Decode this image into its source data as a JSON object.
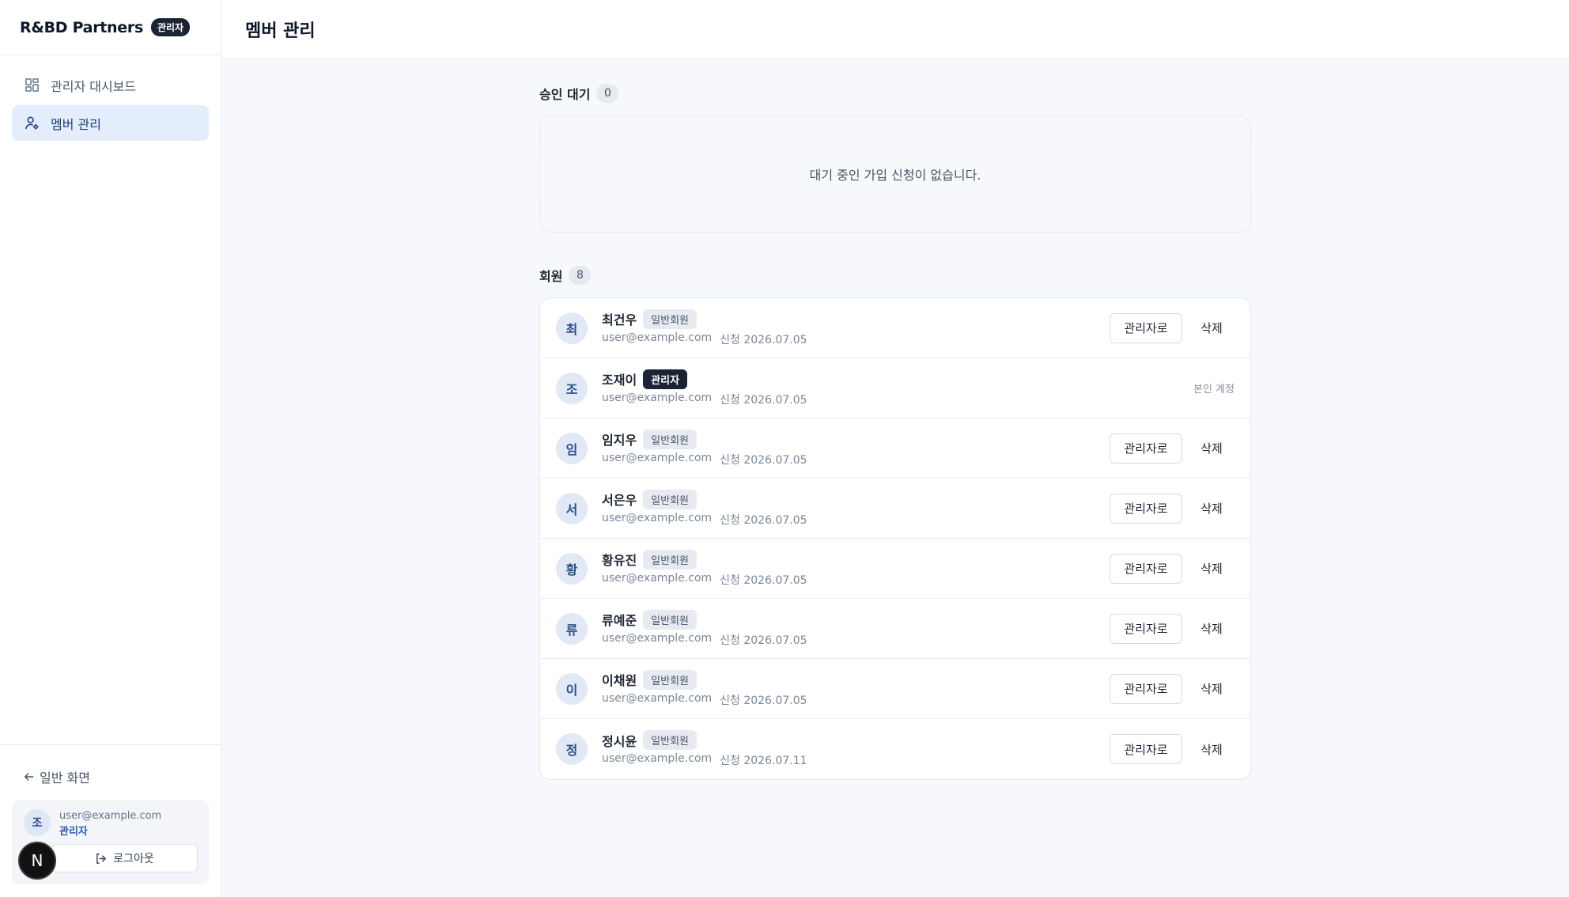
{
  "brand": {
    "name": "R&BD Partners",
    "badge": "관리자"
  },
  "nav": {
    "items": [
      {
        "label": "관리자 대시보드",
        "icon": "grid-icon",
        "active": false
      },
      {
        "label": "멤버 관리",
        "icon": "user-gear-icon",
        "active": true
      }
    ]
  },
  "sidebar_bottom": {
    "back_label": "일반 화면",
    "user": {
      "avatar": "조",
      "email": "user@example.com",
      "role": "관리자"
    },
    "logout_label": "로그아웃",
    "dev_badge": "N"
  },
  "header": {
    "title": "멤버 관리"
  },
  "pending": {
    "title": "승인 대기",
    "count": "0",
    "empty_message": "대기 중인 가입 신청이 없습니다."
  },
  "members": {
    "title": "회원",
    "count": "8",
    "promote_label": "관리자로",
    "delete_label": "삭제",
    "self_label": "본인 계정",
    "rows": [
      {
        "avatar": "최",
        "name": "최건우",
        "role": "일반회원",
        "is_admin": false,
        "email": "user@example.com",
        "applied": "신청 2026.07.05"
      },
      {
        "avatar": "조",
        "name": "조재이",
        "role": "관리자",
        "is_admin": true,
        "email": "user@example.com",
        "applied": "신청 2026.07.05"
      },
      {
        "avatar": "임",
        "name": "임지우",
        "role": "일반회원",
        "is_admin": false,
        "email": "user@example.com",
        "applied": "신청 2026.07.05"
      },
      {
        "avatar": "서",
        "name": "서은우",
        "role": "일반회원",
        "is_admin": false,
        "email": "user@example.com",
        "applied": "신청 2026.07.05"
      },
      {
        "avatar": "황",
        "name": "황유진",
        "role": "일반회원",
        "is_admin": false,
        "email": "user@example.com",
        "applied": "신청 2026.07.05"
      },
      {
        "avatar": "류",
        "name": "류예준",
        "role": "일반회원",
        "is_admin": false,
        "email": "user@example.com",
        "applied": "신청 2026.07.05"
      },
      {
        "avatar": "이",
        "name": "이채원",
        "role": "일반회원",
        "is_admin": false,
        "email": "user@example.com",
        "applied": "신청 2026.07.05"
      },
      {
        "avatar": "정",
        "name": "정시윤",
        "role": "일반회원",
        "is_admin": false,
        "email": "user@example.com",
        "applied": "신청 2026.07.11"
      }
    ]
  },
  "colors": {
    "accent": "#1f3f78",
    "active_bg": "#e3edfc",
    "admin_badge": "#1b2434"
  }
}
